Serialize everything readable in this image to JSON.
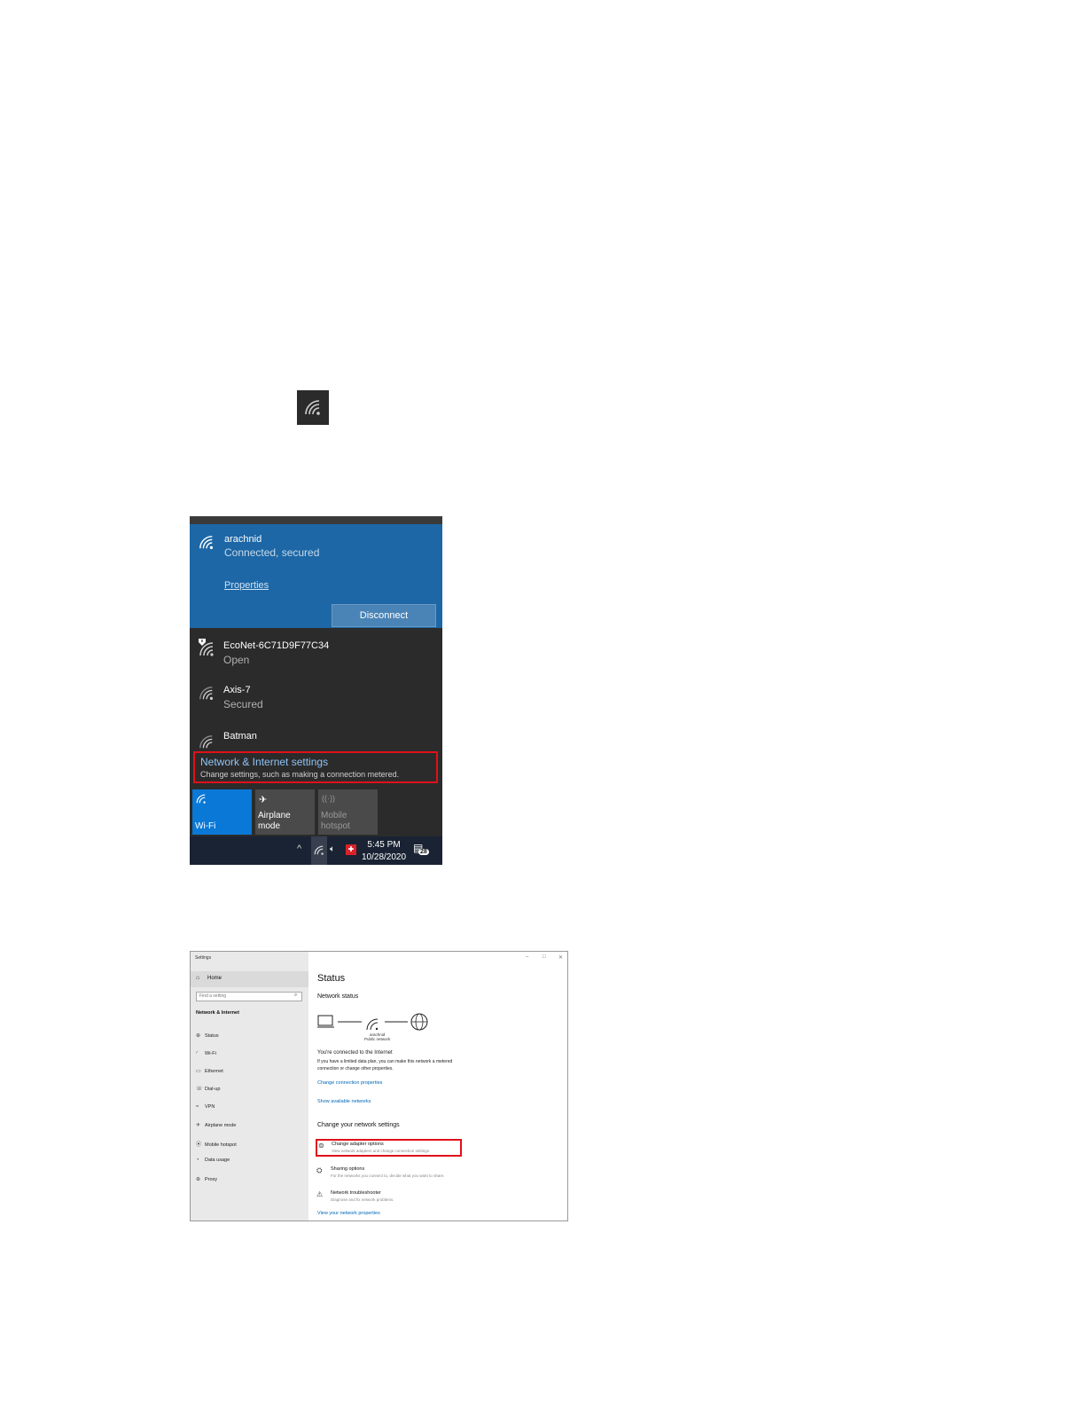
{
  "tray_icon": {
    "icon": "wifi-icon"
  },
  "flyout": {
    "connected": {
      "name": "arachnid",
      "status": "Connected, secured",
      "properties_label": "Properties",
      "disconnect_label": "Disconnect"
    },
    "networks": [
      {
        "name": "EcoNet-6C71D9F77C34",
        "status": "Open",
        "icon": "wifi-warning-icon"
      },
      {
        "name": "Axis-7",
        "status": "Secured",
        "icon": "wifi-icon"
      },
      {
        "name": "Batman",
        "status": "",
        "icon": "wifi-icon"
      }
    ],
    "settings_link": {
      "title": "Network & Internet settings",
      "subtitle": "Change settings, such as making a connection metered."
    },
    "tiles": [
      {
        "label": "Wi-Fi",
        "active": true
      },
      {
        "label": "Airplane mode",
        "active": false
      },
      {
        "label": "Mobile hotspot",
        "active": false
      }
    ],
    "taskbar": {
      "time": "5:45 PM",
      "date": "10/28/2020",
      "notifications": "28"
    }
  },
  "settings": {
    "window_title": "Settings",
    "home_label": "Home",
    "search_placeholder": "Find a setting",
    "section_label": "Network & Internet",
    "nav": [
      "Status",
      "Wi-Fi",
      "Ethernet",
      "Dial-up",
      "VPN",
      "Airplane mode",
      "Mobile hotspot",
      "Data usage",
      "Proxy"
    ],
    "page_title": "Status",
    "network_status_label": "Network status",
    "network_name": "arachnid",
    "network_type": "Public network",
    "connected_text": "You're connected to the Internet",
    "data_plan_text": "If you have a limited data plan, you can make this network a metered connection or change other properties.",
    "change_connection_link": "Change connection properties",
    "show_networks_link": "Show available networks",
    "change_settings_heading": "Change your network settings",
    "options": [
      {
        "title": "Change adapter options",
        "subtitle": "View network adapters and change connection settings."
      },
      {
        "title": "Sharing options",
        "subtitle": "For the networks you connect to, decide what you want to share."
      },
      {
        "title": "Network troubleshooter",
        "subtitle": "Diagnose and fix network problems."
      }
    ],
    "view_properties_link": "View your network properties"
  }
}
